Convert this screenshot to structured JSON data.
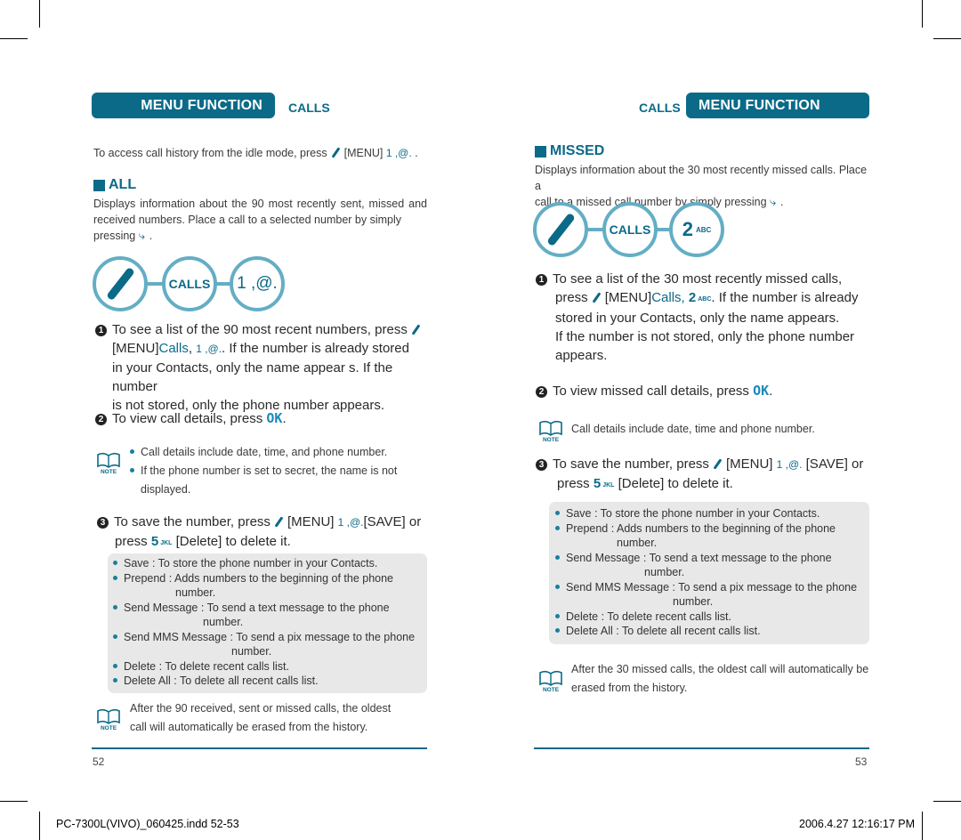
{
  "left": {
    "header": {
      "bar_label": "MENU FUNCTION",
      "side_label": "CALLS"
    },
    "intro": {
      "text": "To access call history from the idle mode, press",
      "menu": "[MENU]",
      "key": "1 ,@.",
      "end": "."
    },
    "section": {
      "title": "ALL",
      "desc_line1": "Displays information about the 90 most recently sent, missed and",
      "desc_line2": "received numbers. Place a call to a selected number by simply",
      "desc_line3": "pressing",
      "desc_end": "."
    },
    "diagram": {
      "icon1": "menu-key",
      "label2": "CALLS",
      "label3": "1 ,@."
    },
    "steps": [
      {
        "num": "1",
        "line1": "To see a list of the 90 most recent numbers, press",
        "line2_a": "[MENU]",
        "line2_calls": "Calls",
        "line2_key": "1 ,@.",
        "line2_b": ". If the number is already stored",
        "line3": "in your Contacts, only the name appear s. If the number",
        "line4": "is not stored, only the phone number appears."
      },
      {
        "num": "2",
        "text": "To view call details, press",
        "key": "OK",
        "end": "."
      },
      {
        "num": "3",
        "line1_a": "To save the number, press",
        "line1_menu": "[MENU]",
        "line1_key": "1 ,@.",
        "line1_b": "[SAVE] or",
        "line2_a": "press",
        "line2_key": "5",
        "line2_key_sub": "JKL",
        "line2_b": "[Delete] to delete it."
      }
    ],
    "note1": {
      "icon_label": "NOTE",
      "bullets": [
        "Call details include date, time, and phone number.",
        "If the phone number is set to secret, the name is not",
        "displayed."
      ]
    },
    "options": [
      {
        "line1": "Save : To store the phone number in your Contacts."
      },
      {
        "line1": "Prepend : Adds numbers to the beginning of the phone",
        "line2": "number."
      },
      {
        "line1": "Send Message : To send a text message to the phone",
        "line2": "number."
      },
      {
        "line1": "Send MMS Message : To send a pix message to the phone",
        "line2": "number."
      },
      {
        "line1": "Delete : To delete recent calls list."
      },
      {
        "line1": "Delete All : To delete all recent calls list."
      }
    ],
    "note2": {
      "icon_label": "NOTE",
      "line1": "After the 90 received, sent or missed calls, the oldest",
      "line2": "call will automatically be erased from the history."
    },
    "page_number": "52"
  },
  "right": {
    "header": {
      "bar_label": "MENU FUNCTION",
      "side_label": "CALLS"
    },
    "section": {
      "title": "MISSED",
      "desc_line1": "Displays information about the 30 most recently missed calls. Place a",
      "desc_line2": "call to a missed call number by simply pressing",
      "desc_end": "."
    },
    "diagram": {
      "icon1": "menu-key",
      "label2": "CALLS",
      "label3_num": "2",
      "label3_sub": "ABC"
    },
    "steps": [
      {
        "num": "1",
        "line1": "To see a list of the 30 most recently missed calls,",
        "line2_a": "press",
        "line2_menu": "[MENU]",
        "line2_calls": "Calls,",
        "line2_key": "2",
        "line2_key_sub": "ABC",
        "line2_b": ". If the number is already",
        "line3": "stored in your Contacts, only the name appears.",
        "line4": "If the number is not stored, only the phone number",
        "line5": "appears."
      },
      {
        "num": "2",
        "text": "To view missed call details, press",
        "key": "OK",
        "end": "."
      },
      {
        "num": "3",
        "line1_a": "To save the number, press",
        "line1_menu": "[MENU]",
        "line1_key": "1 ,@.",
        "line1_b": "[SAVE] or",
        "line2_a": "press",
        "line2_key": "5",
        "line2_key_sub": "JKL",
        "line2_b": "[Delete] to delete it."
      }
    ],
    "note1": {
      "icon_label": "NOTE",
      "text": "Call details include date, time and phone number."
    },
    "options": [
      {
        "line1": "Save : To store the phone number in your Contacts."
      },
      {
        "line1": "Prepend : Adds numbers to the beginning of the phone",
        "line2": "number."
      },
      {
        "line1": "Send Message : To send a text message to the phone",
        "line2": "number."
      },
      {
        "line1": "Send MMS Message : To send a pix message to the phone",
        "line2": "number."
      },
      {
        "line1": "Delete : To delete recent calls list."
      },
      {
        "line1": "Delete All : To delete all recent calls list."
      }
    ],
    "note2": {
      "icon_label": "NOTE",
      "line1": "After the 30 missed calls, the oldest call will automatically be",
      "line2": "erased from the history."
    },
    "page_number": "53"
  },
  "slug": {
    "file": "PC-7300L(VIVO)_060425.indd   52-53",
    "timestamp": "2006.4.27   12:16:17 PM"
  },
  "colors": {
    "accent": "#0a6a88",
    "circle": "#64aec4",
    "option_box": "#e8e8e8"
  }
}
